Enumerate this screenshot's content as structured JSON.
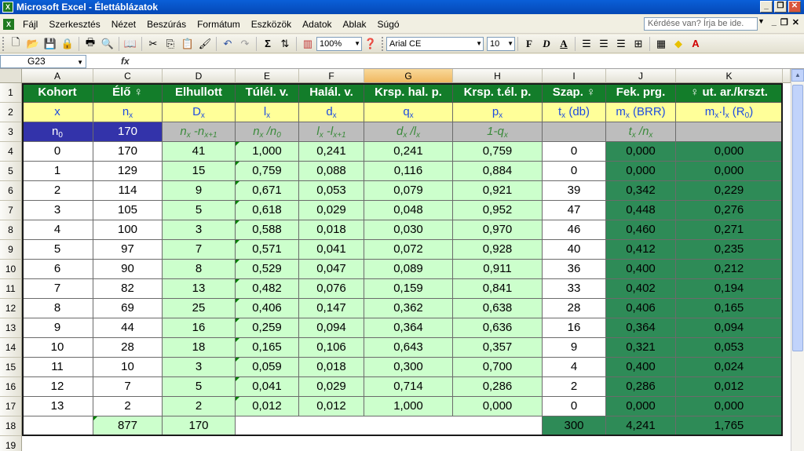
{
  "window": {
    "title": "Microsoft Excel - Élettáblázatok",
    "min": "_",
    "restore": "❐",
    "close": "✕"
  },
  "menu": [
    "Fájl",
    "Szerkesztés",
    "Nézet",
    "Beszúrás",
    "Formátum",
    "Eszközök",
    "Adatok",
    "Ablak",
    "Súgó"
  ],
  "help_placeholder": "Kérdése van? Írja be ide.",
  "toolbar": {
    "zoom": "100%",
    "font": "Arial CE",
    "size": "10",
    "bold": "F",
    "italic": "D",
    "underline": "A"
  },
  "namebox": "G23",
  "fx": "fx",
  "columns": [
    "A",
    "C",
    "D",
    "E",
    "F",
    "G",
    "H",
    "I",
    "J",
    "K"
  ],
  "rows": [
    "1",
    "2",
    "3",
    "4",
    "5",
    "6",
    "7",
    "8",
    "9",
    "10",
    "11",
    "12",
    "13",
    "14",
    "15",
    "16",
    "17",
    "18",
    "19"
  ],
  "header1": [
    "Kohort",
    "Élő ♀",
    "Elhullott",
    "Túlél. v.",
    "Halál. v.",
    "Krsp. hal. p.",
    "Krsp. t.él. p.",
    "Szap. ♀",
    "Fek. prg.",
    "♀ ut. ar./krszt."
  ],
  "header2": [
    {
      "m": "x",
      "s": ""
    },
    {
      "m": "n",
      "s": "x"
    },
    {
      "m": "D",
      "s": "x"
    },
    {
      "m": "l",
      "s": "x"
    },
    {
      "m": "d",
      "s": "x"
    },
    {
      "m": "q",
      "s": "x"
    },
    {
      "m": "p",
      "s": "x"
    },
    {
      "m": "t",
      "s": "x",
      "t": " (db)"
    },
    {
      "m": "m",
      "s": "x",
      "t": " (BRR)"
    },
    {
      "m": "m",
      "s": "x",
      "t": "·l",
      "s2": "x",
      "t2": " (R",
      "s3": "0",
      "t3": ")"
    }
  ],
  "header3": [
    {
      "m": "n",
      "s": "0"
    },
    {
      "m": "170",
      "s": ""
    },
    {
      "m": "n",
      "s": "x",
      "t": " -n",
      "s2": "x+1"
    },
    {
      "m": "n",
      "s": "x",
      "t": " /n",
      "s2": "0"
    },
    {
      "m": "l",
      "s": "x",
      "t": " -l",
      "s2": "x+1"
    },
    {
      "m": "d",
      "s": "x",
      "t": " /l",
      "s2": "x"
    },
    {
      "m": "1-q",
      "s": "x"
    },
    {
      "m": "",
      "s": ""
    },
    {
      "m": "t",
      "s": "x",
      "t": " /n",
      "s2": "x"
    },
    {
      "m": "",
      "s": ""
    }
  ],
  "data": [
    [
      "0",
      "170",
      "41",
      "1,000",
      "0,241",
      "0,241",
      "0,759",
      "0",
      "0,000",
      "0,000"
    ],
    [
      "1",
      "129",
      "15",
      "0,759",
      "0,088",
      "0,116",
      "0,884",
      "0",
      "0,000",
      "0,000"
    ],
    [
      "2",
      "114",
      "9",
      "0,671",
      "0,053",
      "0,079",
      "0,921",
      "39",
      "0,342",
      "0,229"
    ],
    [
      "3",
      "105",
      "5",
      "0,618",
      "0,029",
      "0,048",
      "0,952",
      "47",
      "0,448",
      "0,276"
    ],
    [
      "4",
      "100",
      "3",
      "0,588",
      "0,018",
      "0,030",
      "0,970",
      "46",
      "0,460",
      "0,271"
    ],
    [
      "5",
      "97",
      "7",
      "0,571",
      "0,041",
      "0,072",
      "0,928",
      "40",
      "0,412",
      "0,235"
    ],
    [
      "6",
      "90",
      "8",
      "0,529",
      "0,047",
      "0,089",
      "0,911",
      "36",
      "0,400",
      "0,212"
    ],
    [
      "7",
      "82",
      "13",
      "0,482",
      "0,076",
      "0,159",
      "0,841",
      "33",
      "0,402",
      "0,194"
    ],
    [
      "8",
      "69",
      "25",
      "0,406",
      "0,147",
      "0,362",
      "0,638",
      "28",
      "0,406",
      "0,165"
    ],
    [
      "9",
      "44",
      "16",
      "0,259",
      "0,094",
      "0,364",
      "0,636",
      "16",
      "0,364",
      "0,094"
    ],
    [
      "10",
      "28",
      "18",
      "0,165",
      "0,106",
      "0,643",
      "0,357",
      "9",
      "0,321",
      "0,053"
    ],
    [
      "11",
      "10",
      "3",
      "0,059",
      "0,018",
      "0,300",
      "0,700",
      "4",
      "0,400",
      "0,024"
    ],
    [
      "12",
      "7",
      "5",
      "0,041",
      "0,029",
      "0,714",
      "0,286",
      "2",
      "0,286",
      "0,012"
    ],
    [
      "13",
      "2",
      "2",
      "0,012",
      "0,012",
      "1,000",
      "0,000",
      "0",
      "0,000",
      "0,000"
    ]
  ],
  "totals": [
    "",
    "877",
    "170",
    "",
    "",
    "",
    "",
    "300",
    "4,241",
    "1,765"
  ],
  "colors": {
    "header_green": "#137d2a",
    "header_yellow": "#ffff99",
    "light_green": "#ccffcc",
    "dark_green": "#2e8b57",
    "selected_col": "#f0b860"
  }
}
